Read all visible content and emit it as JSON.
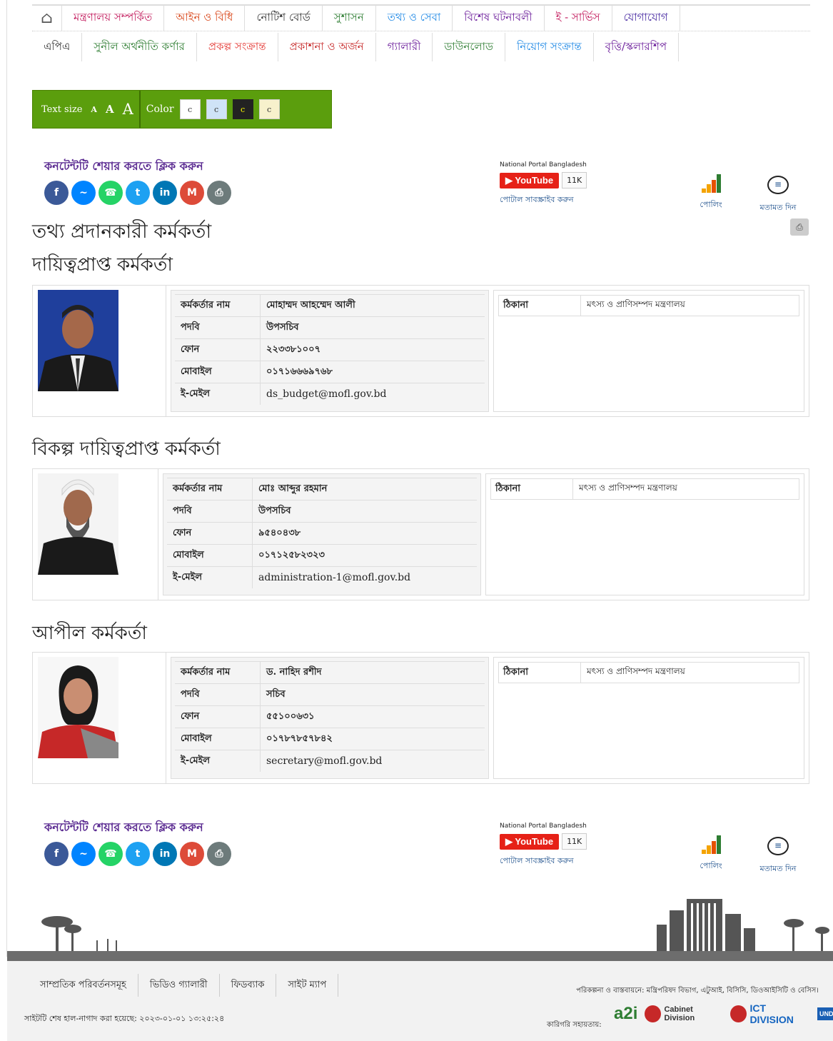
{
  "nav": {
    "row1": [
      {
        "label": "মন্ত্রণালয় সম্পর্কিত",
        "color": "#c2185b"
      },
      {
        "label": "আইন ও বিধি",
        "color": "#d84315"
      },
      {
        "label": "নোটিশ বোর্ড",
        "color": "#333333"
      },
      {
        "label": "সুশাসন",
        "color": "#2e7d32"
      },
      {
        "label": "তথ্য ও সেবা",
        "color": "#1e88e5"
      },
      {
        "label": "বিশেষ ঘটনাবলী",
        "color": "#6a1b9a"
      },
      {
        "label": "ই - সার্ভিস",
        "color": "#c2185b"
      },
      {
        "label": "যোগাযোগ",
        "color": "#4527a0"
      }
    ],
    "row2": [
      {
        "label": "এপিএ",
        "color": "#333333"
      },
      {
        "label": "সুনীল অর্থনীতি কর্ণার",
        "color": "#2e7d32"
      },
      {
        "label": "প্রকল্প সংক্রান্ত",
        "color": "#e53935"
      },
      {
        "label": "প্রকাশনা ও অর্জন",
        "color": "#c62828"
      },
      {
        "label": "গ্যালারী",
        "color": "#6a1b9a"
      },
      {
        "label": "ডাউনলোড",
        "color": "#2e7d32"
      },
      {
        "label": "নিয়োগ সংক্রান্ত",
        "color": "#1e88e5"
      },
      {
        "label": "বৃত্তি/স্কলারশিপ",
        "color": "#6a1b9a"
      }
    ]
  },
  "access": {
    "text_size": "Text size",
    "a_small": "A",
    "a_mid": "A",
    "a_big": "A",
    "color": "Color",
    "swatch": "c"
  },
  "share": {
    "title": "কনটেন্টটি শেয়ার করতে ক্লিক করুন"
  },
  "portal": {
    "name": "National Portal Bangladesh",
    "youtube": "YouTube",
    "count": "11K",
    "subscribe": "পোটাল সাবস্ক্রাইব করুন",
    "poll": "পোলিং",
    "feedback": "মতামত দিন"
  },
  "page": {
    "title": "তথ্য প্রদানকারী কর্মকর্তা",
    "sections": [
      {
        "heading": "দায়িত্বপ্রাপ্ত কর্মকর্তা",
        "name": "মোহাম্মদ আহম্মেদ আলী",
        "designation": "উপসচিব",
        "phone": "২২৩৩৮১০০৭",
        "mobile": "০১৭১৬৬৬৯৭৬৮",
        "email": "ds_budget@mofl.gov.bd",
        "address": "মৎস্য ও প্রাণিসম্পদ মন্ত্রণালয়"
      },
      {
        "heading": "বিকল্প দায়িত্বপ্রাপ্ত কর্মকর্তা",
        "name": "মোঃ আব্দুর রহমান",
        "designation": "উপসচিব",
        "phone": "৯৫৪০৪৩৮",
        "mobile": "০১৭১২৫৮২৩২৩",
        "email": "administration-1@mofl.gov.bd",
        "address": "মৎস্য ও প্রাণিসম্পদ মন্ত্রণালয়"
      },
      {
        "heading": "আপীল কর্মকর্তা",
        "name": "ড. নাহিদ রশীদ",
        "designation": "সচিব",
        "phone": "৫৫১০০৬৩১",
        "mobile": "০১৭৮৭৮৫৭৮৪২",
        "email": "secretary@mofl.gov.bd",
        "address": "মৎস্য ও প্রাণিসম্পদ মন্ত্রণালয়"
      }
    ]
  },
  "labels": {
    "name": "কর্মকর্তার নাম",
    "designation": "পদবি",
    "phone": "ফোন",
    "mobile": "মোবাইল",
    "email": "ই-মেইল",
    "address": "ঠিকানা"
  },
  "footer": {
    "links": [
      "সাম্প্রতিক পরিবর্তনসমূহ",
      "ভিডিও গ্যালারী",
      "ফিডব্যাক",
      "সাইট ম্যাপ"
    ],
    "updated": "সাইটটি শেষ হাল-নাগাদ করা হয়েছে: ২০২৩-০১-০১ ১৩:২৫:২৪",
    "credits": "পরিকল্পনা ও বাস্তবায়নে: মন্ত্রিপরিষদ বিভাগ, এটুআই, বিসিসি, ডিওআইসিটি ও বেসিস।",
    "tech": "কারিগরি সহায়তায়:",
    "logos": [
      "a2i",
      "Cabinet Division",
      "ICT DIVISION",
      "UNDP"
    ]
  }
}
